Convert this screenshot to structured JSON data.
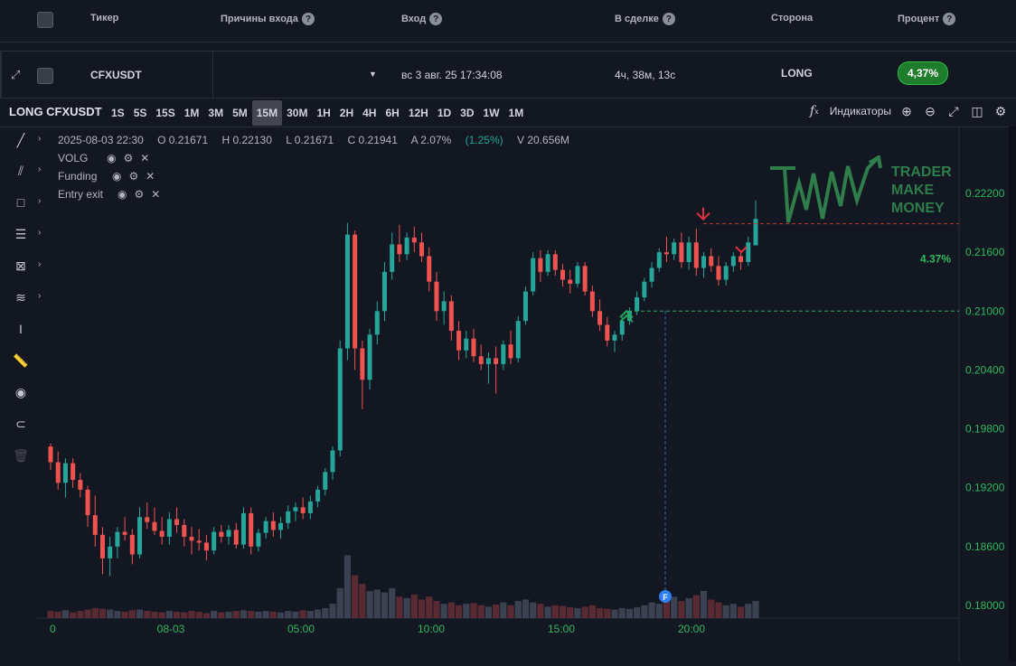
{
  "table": {
    "headers": [
      {
        "label": "Тикер",
        "help": false
      },
      {
        "label": "Причины входа",
        "help": true
      },
      {
        "label": "Вход",
        "help": true
      },
      {
        "label": "В сделке",
        "help": true
      },
      {
        "label": "Сторона",
        "help": false
      },
      {
        "label": "Процент",
        "help": true
      }
    ],
    "row": {
      "ticker": "CFXUSDT",
      "entry": "вс 3 авг. 25 17:34:08",
      "duration": "4ч, 38м, 13с",
      "side": "LONG",
      "percent": "4,37%"
    }
  },
  "toolbar": {
    "symbol": "LONG CFXUSDT",
    "timeframes": [
      "1S",
      "5S",
      "15S",
      "1M",
      "3M",
      "5M",
      "15M",
      "30M",
      "1H",
      "2H",
      "4H",
      "6H",
      "12H",
      "1D",
      "3D",
      "1W",
      "1M"
    ],
    "active_timeframe": "15M",
    "indicators_label": "Индикаторы"
  },
  "legend": {
    "date": "2025-08-03 22:30",
    "open": "O 0.21671",
    "high": "H 0.22130",
    "low": "L 0.21671",
    "close": "C 0.21941",
    "amp": "A 2.07%",
    "change": "(1.25%)",
    "volume": "V 20.656M"
  },
  "indicators": [
    "VOLG",
    "Funding",
    "Entry exit"
  ],
  "chart_data": {
    "type": "candlestick",
    "y_ticks": [
      "0.22200",
      "0.21600",
      "0.21000",
      "0.20400",
      "0.19800",
      "0.19200",
      "0.18600",
      "0.18000"
    ],
    "x_ticks": [
      "0",
      "08-03",
      "05:00",
      "10:00",
      "15:00",
      "20:00"
    ],
    "ylim": [
      0.179,
      0.2235
    ],
    "take_profit_label": "4.37%",
    "entry_level": 0.21,
    "exit_level": 0.2189,
    "colors": {
      "up": "#26a69a",
      "down": "#ef5350"
    },
    "candles": [
      [
        0.1962,
        0.1965,
        0.1938,
        0.1946
      ],
      [
        0.1946,
        0.1957,
        0.1918,
        0.1925
      ],
      [
        0.1925,
        0.195,
        0.191,
        0.1945
      ],
      [
        0.1945,
        0.195,
        0.192,
        0.1928
      ],
      [
        0.1928,
        0.1935,
        0.191,
        0.1918
      ],
      [
        0.1918,
        0.1922,
        0.188,
        0.1892
      ],
      [
        0.1892,
        0.1912,
        0.186,
        0.1872
      ],
      [
        0.1872,
        0.188,
        0.1832,
        0.1848
      ],
      [
        0.1848,
        0.187,
        0.183,
        0.186
      ],
      [
        0.186,
        0.188,
        0.1848,
        0.1875
      ],
      [
        0.1875,
        0.189,
        0.1866,
        0.1872
      ],
      [
        0.1872,
        0.1878,
        0.1842,
        0.1852
      ],
      [
        0.1852,
        0.19,
        0.1848,
        0.189
      ],
      [
        0.189,
        0.1905,
        0.1878,
        0.1885
      ],
      [
        0.1885,
        0.19,
        0.1872,
        0.1876
      ],
      [
        0.1876,
        0.189,
        0.1862,
        0.187
      ],
      [
        0.187,
        0.1895,
        0.1862,
        0.1888
      ],
      [
        0.1888,
        0.19,
        0.1874,
        0.1882
      ],
      [
        0.1882,
        0.1888,
        0.186,
        0.187
      ],
      [
        0.187,
        0.188,
        0.1852,
        0.1866
      ],
      [
        0.1866,
        0.1878,
        0.1856,
        0.1864
      ],
      [
        0.1864,
        0.1872,
        0.1846,
        0.1856
      ],
      [
        0.1856,
        0.188,
        0.1852,
        0.1875
      ],
      [
        0.1875,
        0.1882,
        0.1864,
        0.187
      ],
      [
        0.187,
        0.1882,
        0.1862,
        0.1877
      ],
      [
        0.1877,
        0.1884,
        0.1858,
        0.1862
      ],
      [
        0.1862,
        0.19,
        0.1858,
        0.1894
      ],
      [
        0.1894,
        0.19,
        0.1852,
        0.186
      ],
      [
        0.186,
        0.1878,
        0.1855,
        0.1874
      ],
      [
        0.1874,
        0.189,
        0.1868,
        0.1886
      ],
      [
        0.1886,
        0.1895,
        0.187,
        0.1877
      ],
      [
        0.1877,
        0.189,
        0.1868,
        0.1884
      ],
      [
        0.1884,
        0.1902,
        0.1878,
        0.1896
      ],
      [
        0.1896,
        0.1905,
        0.1886,
        0.19
      ],
      [
        0.19,
        0.191,
        0.1888,
        0.1894
      ],
      [
        0.1894,
        0.1912,
        0.1888,
        0.1906
      ],
      [
        0.1906,
        0.1922,
        0.19,
        0.1918
      ],
      [
        0.1918,
        0.194,
        0.1912,
        0.1936
      ],
      [
        0.1936,
        0.1962,
        0.1928,
        0.1958
      ],
      [
        0.1958,
        0.207,
        0.1952,
        0.2062
      ],
      [
        0.2062,
        0.219,
        0.205,
        0.2178
      ],
      [
        0.2178,
        0.2182,
        0.204,
        0.2062
      ],
      [
        0.2062,
        0.207,
        0.2,
        0.203
      ],
      [
        0.203,
        0.2082,
        0.202,
        0.2076
      ],
      [
        0.2076,
        0.211,
        0.2066,
        0.21
      ],
      [
        0.21,
        0.215,
        0.209,
        0.214
      ],
      [
        0.214,
        0.218,
        0.2132,
        0.2168
      ],
      [
        0.2168,
        0.2188,
        0.215,
        0.2158
      ],
      [
        0.2158,
        0.218,
        0.2152,
        0.2175
      ],
      [
        0.2175,
        0.2186,
        0.216,
        0.217
      ],
      [
        0.217,
        0.218,
        0.215,
        0.2156
      ],
      [
        0.2156,
        0.2165,
        0.212,
        0.213
      ],
      [
        0.213,
        0.214,
        0.209,
        0.21
      ],
      [
        0.21,
        0.212,
        0.2086,
        0.211
      ],
      [
        0.211,
        0.2116,
        0.207,
        0.208
      ],
      [
        0.208,
        0.209,
        0.205,
        0.206
      ],
      [
        0.206,
        0.208,
        0.2052,
        0.2072
      ],
      [
        0.2072,
        0.2082,
        0.2048,
        0.2054
      ],
      [
        0.2054,
        0.2066,
        0.204,
        0.2046
      ],
      [
        0.2046,
        0.2058,
        0.2026,
        0.2052
      ],
      [
        0.2052,
        0.2064,
        0.2016,
        0.2046
      ],
      [
        0.2046,
        0.207,
        0.204,
        0.2066
      ],
      [
        0.2066,
        0.208,
        0.2046,
        0.2052
      ],
      [
        0.2052,
        0.2095,
        0.2048,
        0.209
      ],
      [
        0.209,
        0.2125,
        0.2086,
        0.212
      ],
      [
        0.212,
        0.216,
        0.2116,
        0.2154
      ],
      [
        0.2154,
        0.2162,
        0.213,
        0.214
      ],
      [
        0.214,
        0.2162,
        0.2136,
        0.2158
      ],
      [
        0.2158,
        0.2162,
        0.2136,
        0.2142
      ],
      [
        0.2142,
        0.2148,
        0.2125,
        0.2132
      ],
      [
        0.2132,
        0.2142,
        0.2118,
        0.2128
      ],
      [
        0.2128,
        0.215,
        0.2124,
        0.2146
      ],
      [
        0.2146,
        0.215,
        0.2116,
        0.212
      ],
      [
        0.212,
        0.2126,
        0.2094,
        0.21
      ],
      [
        0.21,
        0.2112,
        0.208,
        0.2086
      ],
      [
        0.2086,
        0.2094,
        0.2064,
        0.207
      ],
      [
        0.207,
        0.208,
        0.2058,
        0.2076
      ],
      [
        0.2076,
        0.2094,
        0.207,
        0.209
      ],
      [
        0.209,
        0.2104,
        0.2086,
        0.21
      ],
      [
        0.21,
        0.212,
        0.2096,
        0.2114
      ],
      [
        0.2114,
        0.2134,
        0.211,
        0.213
      ],
      [
        0.213,
        0.215,
        0.2124,
        0.2144
      ],
      [
        0.2144,
        0.2164,
        0.214,
        0.216
      ],
      [
        0.216,
        0.2176,
        0.215,
        0.2158
      ],
      [
        0.2158,
        0.2174,
        0.2152,
        0.217
      ],
      [
        0.217,
        0.218,
        0.2144,
        0.215
      ],
      [
        0.215,
        0.2176,
        0.2142,
        0.217
      ],
      [
        0.217,
        0.2184,
        0.2136,
        0.2144
      ],
      [
        0.2144,
        0.216,
        0.2134,
        0.2156
      ],
      [
        0.2156,
        0.2164,
        0.214,
        0.2146
      ],
      [
        0.2146,
        0.2156,
        0.2126,
        0.2132
      ],
      [
        0.2132,
        0.215,
        0.2126,
        0.2146
      ],
      [
        0.2146,
        0.216,
        0.214,
        0.2156
      ],
      [
        0.2156,
        0.2162,
        0.2142,
        0.215
      ],
      [
        0.215,
        0.2176,
        0.2146,
        0.217
      ],
      [
        0.2167,
        0.2213,
        0.2167,
        0.2194
      ]
    ],
    "volumes": [
      0.1,
      0.09,
      0.11,
      0.08,
      0.1,
      0.12,
      0.14,
      0.13,
      0.12,
      0.1,
      0.09,
      0.11,
      0.12,
      0.1,
      0.09,
      0.08,
      0.1,
      0.09,
      0.08,
      0.1,
      0.09,
      0.07,
      0.1,
      0.08,
      0.09,
      0.1,
      0.11,
      0.1,
      0.09,
      0.1,
      0.09,
      0.08,
      0.1,
      0.09,
      0.11,
      0.1,
      0.12,
      0.14,
      0.2,
      0.42,
      0.88,
      0.6,
      0.48,
      0.38,
      0.4,
      0.36,
      0.42,
      0.3,
      0.28,
      0.33,
      0.26,
      0.3,
      0.24,
      0.2,
      0.22,
      0.18,
      0.2,
      0.21,
      0.18,
      0.16,
      0.19,
      0.22,
      0.18,
      0.24,
      0.26,
      0.22,
      0.2,
      0.16,
      0.18,
      0.17,
      0.15,
      0.14,
      0.16,
      0.18,
      0.14,
      0.13,
      0.12,
      0.14,
      0.13,
      0.15,
      0.18,
      0.22,
      0.2,
      0.26,
      0.3,
      0.24,
      0.28,
      0.32,
      0.38,
      0.26,
      0.22,
      0.18,
      0.2,
      0.16,
      0.2,
      0.24
    ]
  },
  "logo": {
    "line1": "TRADER",
    "line2": "MAKE",
    "line3": "MONEY"
  },
  "funding_marker": "F"
}
